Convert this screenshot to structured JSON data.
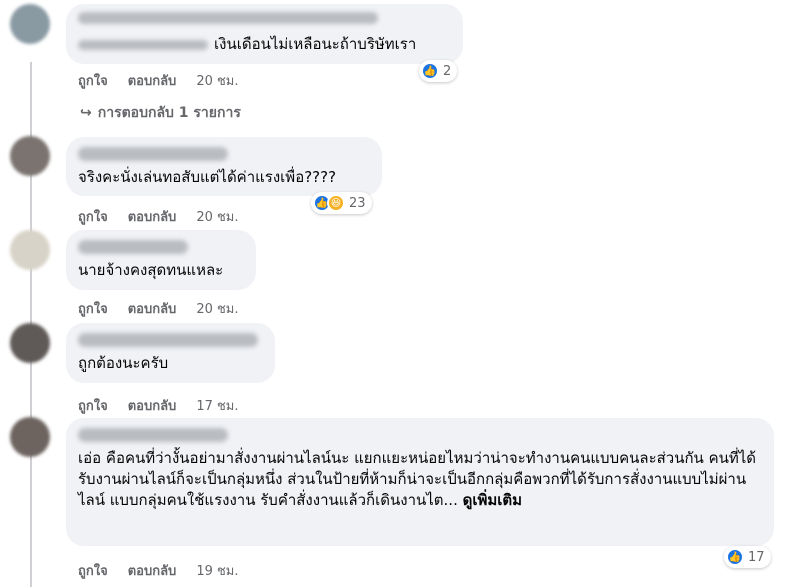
{
  "comments": [
    {
      "text": "เงินเดือนไม่เหลือนะถ้าบริษัทเรา",
      "like_label": "ถูกใจ",
      "reply_label": "ตอบกลับ",
      "time": "20 ชม.",
      "reaction_count": "2",
      "reactions": [
        "like-icon"
      ]
    },
    {
      "text": "จริงคะนั่งเล่นทอสับแต่ได้ค่าแรงเพื่อ????",
      "like_label": "ถูกใจ",
      "reply_label": "ตอบกลับ",
      "time": "20 ชม.",
      "reaction_count": "23",
      "reactions": [
        "like-icon",
        "haha-icon"
      ]
    },
    {
      "text": "นายจ้างคงสุดทนแหละ",
      "like_label": "ถูกใจ",
      "reply_label": "ตอบกลับ",
      "time": "20 ชม."
    },
    {
      "text": "ถูกต้องนะครับ",
      "like_label": "ถูกใจ",
      "reply_label": "ตอบกลับ",
      "time": "17 ชม."
    },
    {
      "text": "เอ่อ คือคนที่ว่างั้นอย่ามาสั่งงานผ่านไลน์นะ แยกแยะหน่อยไหมว่าน่าจะทำงานคนแบบคนละส่วนกัน คนที่ได้รับงานผ่านไลน์ก็จะเป็นกลุ่มหนึ่ง ส่วนในป้ายที่ห้ามก็น่าจะเป็นอีกกลุ่มคือพวกที่ได้รับการสั่งงานแบบไม่ผ่านไลน์ แบบกลุ่มคนใช้แรงงาน รับคำสั่งงานแล้วก็เดินงานไต...",
      "see_more": "ดูเพิ่มเติม",
      "like_label": "ถูกใจ",
      "reply_label": "ตอบกลับ",
      "time": "19 ชม.",
      "reaction_count": "17",
      "reactions": [
        "like-icon"
      ]
    }
  ],
  "replies_link": {
    "label": "การตอบกลับ 1 รายการ",
    "icon": "reply-arrow-icon"
  },
  "colors": {
    "bubble": "#f0f2f5",
    "meta": "#65676b",
    "like": "#1b74e4",
    "haha": "#f7b125",
    "thread": "#ced0d4"
  }
}
